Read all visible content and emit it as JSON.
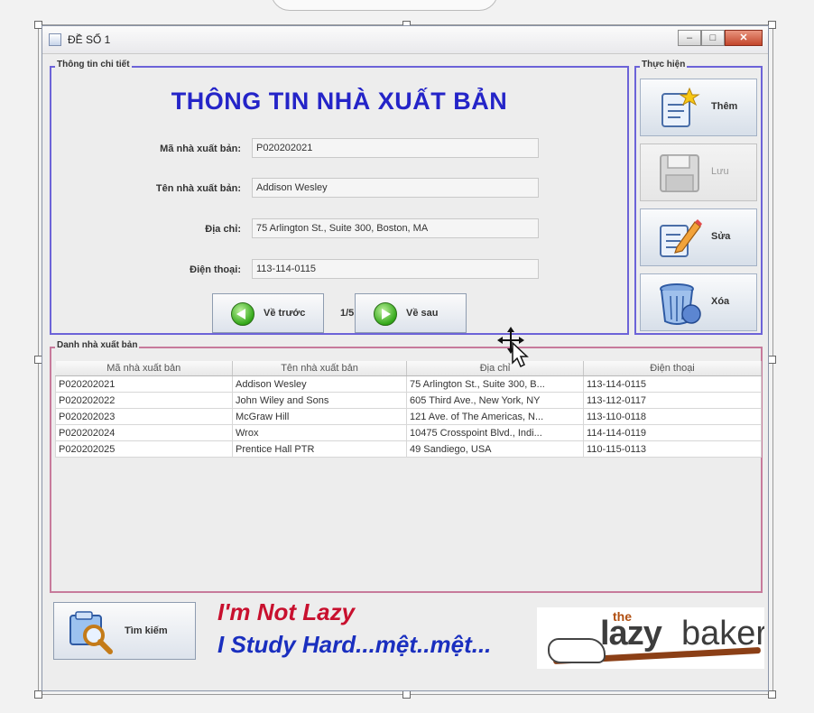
{
  "window": {
    "title": "ĐỀ SỐ 1"
  },
  "details_group": {
    "legend": "Thông tin chi tiết",
    "heading": "THÔNG TIN  NHÀ XUẤT BẢN",
    "fields": [
      {
        "label": "Mã nhà xuất bản:",
        "value": "P020202021"
      },
      {
        "label": "Tên nhà xuất bản:",
        "value": "Addison Wesley"
      },
      {
        "label": "Địa chỉ:",
        "value": "75 Arlington St., Suite 300, Boston, MA"
      },
      {
        "label": "Điện thoại:",
        "value": "113-114-0115"
      }
    ],
    "nav": {
      "prev_label": "Về trước",
      "next_label": "Về sau",
      "page": "1/5"
    }
  },
  "actions_group": {
    "legend": "Thực hiện",
    "buttons": [
      {
        "label": "Thêm",
        "enabled": true
      },
      {
        "label": "Lưu",
        "enabled": false
      },
      {
        "label": "Sửa",
        "enabled": true
      },
      {
        "label": "Xóa",
        "enabled": true
      }
    ]
  },
  "list_group": {
    "legend": "Danh nhà xuất bản",
    "columns": [
      "Mã nhà xuất bản",
      "Tên nhà xuất bản",
      "Địa chỉ",
      "Điện thoại"
    ],
    "rows": [
      [
        "P020202021",
        "Addison Wesley",
        "75 Arlington St., Suite 300, B...",
        "113-114-0115"
      ],
      [
        "P020202022",
        "John Wiley and Sons",
        "605 Third Ave., New York, NY",
        "113-112-0117"
      ],
      [
        "P020202023",
        "McGraw Hill",
        "121 Ave. of The Americas, N...",
        "113-110-0118"
      ],
      [
        "P020202024",
        "Wrox",
        "10475 Crosspoint Blvd., Indi...",
        "114-114-0119"
      ],
      [
        "P020202025",
        "Prentice Hall PTR",
        "49 Sandiego, USA",
        "110-115-0113"
      ]
    ]
  },
  "footer": {
    "search_label": "Tìm kiếm",
    "slogan_line1": "I'm Not Lazy",
    "slogan_line2": "I Study Hard...mệt..mệt...",
    "logo_the": "the",
    "logo_lazy": "lazy",
    "logo_baker": "baker"
  },
  "colors": {
    "heading": "#2424c8",
    "slogan_red": "#c8102e",
    "slogan_blue": "#1a2fbf",
    "border_blue": "#6c63d8"
  }
}
